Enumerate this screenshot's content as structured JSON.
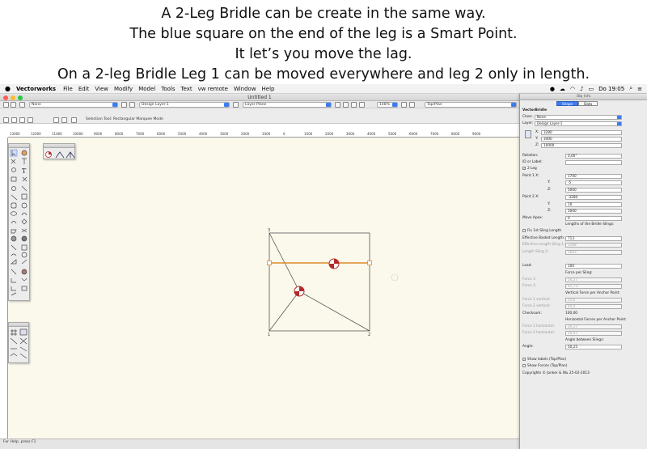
{
  "caption": {
    "line1": "A 2-Leg Bridle can be create in the same way.",
    "line2": "The blue square on the end of the leg is a Smart Point.",
    "line3": "It let’s you move the lag.",
    "line4": "On a 2-leg Bridle Leg 1 can be moved everywhere and leg 2 only in length."
  },
  "menubar": {
    "apple": "",
    "app_name": "Vectorworks",
    "items": [
      "File",
      "Edit",
      "View",
      "Modify",
      "Model",
      "Tools",
      "Text",
      "vw remote",
      "Window",
      "Help"
    ],
    "clock": "Do 19:05"
  },
  "window": {
    "title": "Untitled 1"
  },
  "view_bar": {
    "class_value": "None",
    "layer_value": "Design Layer-1",
    "plane_value": "Layer Plane",
    "zoom_value": "148%",
    "view_value": "Top/Plan"
  },
  "mode_bar": {
    "mode_text": "Selection Tool: Rectangular Marquee Mode"
  },
  "ruler": {
    "top_labels": [
      "13000",
      "12000",
      "11000",
      "10000",
      "9000",
      "8000",
      "7000",
      "6000",
      "5000",
      "4000",
      "3000",
      "2000",
      "1000",
      "0",
      "1000",
      "2000",
      "3000",
      "4000",
      "5000",
      "6000",
      "7000",
      "8000",
      "9000"
    ]
  },
  "drawing": {
    "label_top_left": "3",
    "label_bottom_left": "1",
    "label_bottom_right": "2"
  },
  "status": {
    "text": "For Help, press F1"
  },
  "oip": {
    "header": "Obj Info",
    "tabs": [
      "Shape",
      "Data"
    ],
    "object_type": "VectorBridle",
    "class_label": "Class:",
    "class_value": "None",
    "layer_label": "Layer:",
    "layer_value": "Design Layer-1",
    "x_label": "X:",
    "x_value": "3280",
    "y_label": "Y:",
    "y_value": "3400",
    "z_label": "Z:",
    "z_value": "10000",
    "rotation_label": "Rotation:",
    "rotation_value": "0,00°",
    "id_label": "ID or Label:",
    "id_value": "",
    "leg_count_label": "2 Leg",
    "p1x_label": "Point 1 X:",
    "p1x_value": "1700",
    "p1y_label": "Y:",
    "p1y_value": "-5",
    "p1z_label": "Z:",
    "p1z_value": "5000",
    "p2x_label": "Point 2 X:",
    "p2x_value": "-3280",
    "p2y_label": "Y:",
    "p2y_value": "10",
    "p2z_label": "Z:",
    "p2z_value": "5000",
    "move_apex_label": "Move Apex:",
    "move_apex_value": "0",
    "lengths_heading": "Lengths of the Bridle Slings:",
    "fix_first_label": "Fix 1st Sling Length",
    "eff_basket_label": "Effective Basket Length:",
    "eff_basket_value": "713",
    "eff_len1_label": "Effective Length Sling 1:",
    "eff_len1_value": "3268",
    "len_sling2_label": "Length Sling 2:",
    "len_sling2_value": "2683",
    "load_label": "Load:",
    "load_value": "100",
    "force_heading": "Force per Sling:",
    "force1_label": "Force 1:",
    "force1_value": "56,27",
    "force2_label": "Force 2:",
    "force2_value": "41,73",
    "vertical_heading": "Vertical Force per Anchor Point:",
    "f1v_label": "Force 1 vertical:",
    "f1v_value": "55,6",
    "f2v_label": "Force 2 vertical:",
    "f2v_value": "44,4",
    "checksum_label": "Checksum:",
    "checksum_value": "100,00",
    "horizontal_heading": "Horizontal Forces per Anchor Point:",
    "f1h_label": "Force 1 horizontal:",
    "f1h_value": "20,37",
    "f2h_label": "Force 2 horizontal:",
    "f2h_value": "20,47",
    "angle_heading": "Angle between Slings:",
    "angle_label": "Angle:",
    "angle_value": "50,25",
    "show_labels": "Show labels (Top/Plan)",
    "show_forces": "Show Forces (Top/Plan)",
    "copyright": "Copyrights © Jonker & Wu 25-02-2013"
  },
  "colors": {
    "canvas_bg": "#fbf9ec",
    "leg_orange": "#d98a2a",
    "accent_blue": "#3b7cf4",
    "marker_red": "#b42a2a"
  }
}
